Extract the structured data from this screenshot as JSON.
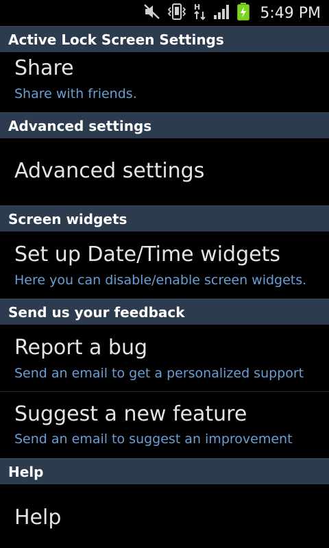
{
  "status_bar": {
    "time": "5:49 PM",
    "icons": [
      "mute-icon",
      "vibrate-icon",
      "hspa-data-icon",
      "signal-icon",
      "battery-charging-icon"
    ]
  },
  "sections": [
    {
      "header": "Active Lock Screen Settings",
      "items": [
        {
          "title": "Share",
          "subtitle": "Share with friends."
        }
      ]
    },
    {
      "header": "Advanced settings",
      "items": [
        {
          "title": "Advanced settings",
          "subtitle": ""
        }
      ]
    },
    {
      "header": "Screen widgets",
      "items": [
        {
          "title": "Set up Date/Time widgets",
          "subtitle": "Here you can disable/enable screen widgets."
        }
      ]
    },
    {
      "header": "Send us your feedback",
      "items": [
        {
          "title": "Report a bug",
          "subtitle": "Send an email to get a personalized support"
        },
        {
          "title": "Suggest a new feature",
          "subtitle": "Send an email to suggest an improvement"
        }
      ]
    },
    {
      "header": "Help",
      "items": [
        {
          "title": "Help",
          "subtitle": ""
        }
      ]
    }
  ],
  "colors": {
    "header_bg": "#2c3b4e",
    "subtitle": "#6a9fd6",
    "title": "#e4e4e4",
    "battery": "#7ed321"
  }
}
